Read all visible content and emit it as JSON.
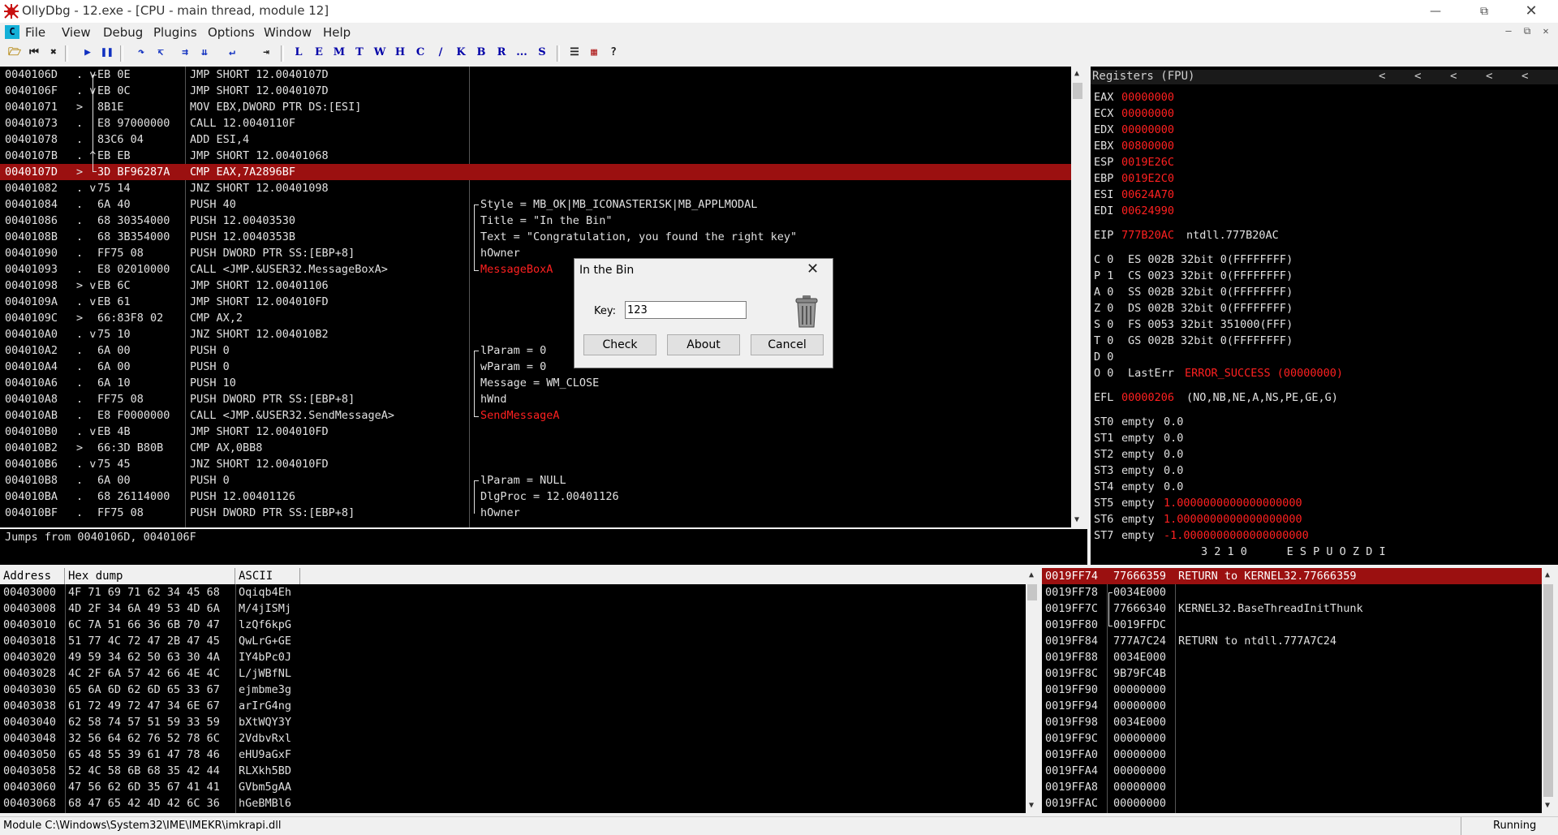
{
  "window": {
    "title": "OllyDbg - 12.exe - [CPU - main thread, module 12]"
  },
  "menu": [
    {
      "label": "File"
    },
    {
      "label": "View"
    },
    {
      "label": "Debug"
    },
    {
      "label": "Plugins"
    },
    {
      "label": "Options"
    },
    {
      "label": "Window"
    },
    {
      "label": "Help"
    }
  ],
  "toolbar_letters": [
    "L",
    "E",
    "M",
    "T",
    "W",
    "H",
    "C",
    "/",
    "K",
    "B",
    "R",
    "...",
    "S"
  ],
  "disasm": [
    {
      "addr": "0040106D",
      "mark": ". v",
      "hex": "EB 0E",
      "cmd": "JMP SHORT 12.0040107D",
      "cmt": ""
    },
    {
      "addr": "0040106F",
      "mark": ". v",
      "hex": "EB 0C",
      "cmd": "JMP SHORT 12.0040107D",
      "cmt": ""
    },
    {
      "addr": "00401071",
      "mark": ">",
      "hex": "8B1E",
      "cmd": "MOV EBX,DWORD PTR DS:[ESI]",
      "cmt": ""
    },
    {
      "addr": "00401073",
      "mark": ".",
      "hex": "E8 97000000",
      "cmd": "CALL 12.0040110F",
      "cmt": ""
    },
    {
      "addr": "00401078",
      "mark": ".",
      "hex": "83C6 04",
      "cmd": "ADD ESI,4",
      "cmt": ""
    },
    {
      "addr": "0040107B",
      "mark": ". ^",
      "hex": "EB EB",
      "cmd": "JMP SHORT 12.00401068",
      "cmt": ""
    },
    {
      "addr": "0040107D",
      "mark": ">",
      "hex": "3D BF96287A",
      "cmd": "CMP EAX,7A2896BF",
      "cmt": ""
    },
    {
      "addr": "00401082",
      "mark": ". v",
      "hex": "75 14",
      "cmd": "JNZ SHORT 12.00401098",
      "cmt": ""
    },
    {
      "addr": "00401084",
      "mark": ".",
      "hex": "6A 40",
      "cmd": "PUSH 40",
      "cmt": "Style = MB_OK|MB_ICONASTERISK|MB_APPLMODAL"
    },
    {
      "addr": "00401086",
      "mark": ".",
      "hex": "68 30354000",
      "cmd": "PUSH 12.00403530",
      "cmt": "Title = \"In the Bin\""
    },
    {
      "addr": "0040108B",
      "mark": ".",
      "hex": "68 3B354000",
      "cmd": "PUSH 12.0040353B",
      "cmt": "Text = \"Congratulation, you found the right key\""
    },
    {
      "addr": "00401090",
      "mark": ".",
      "hex": "FF75 08",
      "cmd": "PUSH DWORD PTR SS:[EBP+8]",
      "cmt": "hOwner"
    },
    {
      "addr": "00401093",
      "mark": ".",
      "hex": "E8 02010000",
      "cmd": "CALL <JMP.&USER32.MessageBoxA>",
      "cmt": "MessageBoxA"
    },
    {
      "addr": "00401098",
      "mark": "> v",
      "hex": "EB 6C",
      "cmd": "JMP SHORT 12.00401106",
      "cmt": ""
    },
    {
      "addr": "0040109A",
      "mark": ". v",
      "hex": "EB 61",
      "cmd": "JMP SHORT 12.004010FD",
      "cmt": ""
    },
    {
      "addr": "0040109C",
      "mark": ">",
      "hex": "66:83F8 02",
      "cmd": "CMP AX,2",
      "cmt": ""
    },
    {
      "addr": "004010A0",
      "mark": ". v",
      "hex": "75 10",
      "cmd": "JNZ SHORT 12.004010B2",
      "cmt": ""
    },
    {
      "addr": "004010A2",
      "mark": ".",
      "hex": "6A 00",
      "cmd": "PUSH 0",
      "cmt": "lParam = 0"
    },
    {
      "addr": "004010A4",
      "mark": ".",
      "hex": "6A 00",
      "cmd": "PUSH 0",
      "cmt": "wParam = 0"
    },
    {
      "addr": "004010A6",
      "mark": ".",
      "hex": "6A 10",
      "cmd": "PUSH 10",
      "cmt": "Message = WM_CLOSE"
    },
    {
      "addr": "004010A8",
      "mark": ".",
      "hex": "FF75 08",
      "cmd": "PUSH DWORD PTR SS:[EBP+8]",
      "cmt": "hWnd"
    },
    {
      "addr": "004010AB",
      "mark": ".",
      "hex": "E8 F0000000",
      "cmd": "CALL <JMP.&USER32.SendMessageA>",
      "cmt": "SendMessageA"
    },
    {
      "addr": "004010B0",
      "mark": ". v",
      "hex": "EB 4B",
      "cmd": "JMP SHORT 12.004010FD",
      "cmt": ""
    },
    {
      "addr": "004010B2",
      "mark": ">",
      "hex": "66:3D B80B",
      "cmd": "CMP AX,0BB8",
      "cmt": ""
    },
    {
      "addr": "004010B6",
      "mark": ". v",
      "hex": "75 45",
      "cmd": "JNZ SHORT 12.004010FD",
      "cmt": ""
    },
    {
      "addr": "004010B8",
      "mark": ".",
      "hex": "6A 00",
      "cmd": "PUSH 0",
      "cmt": "lParam = NULL"
    },
    {
      "addr": "004010BA",
      "mark": ".",
      "hex": "68 26114000",
      "cmd": "PUSH 12.00401126",
      "cmt": "DlgProc = 12.00401126"
    },
    {
      "addr": "004010BF",
      "mark": ".",
      "hex": "FF75 08",
      "cmd": "PUSH DWORD PTR SS:[EBP+8]",
      "cmt": "hOwner"
    }
  ],
  "info_line": "Jumps from 0040106D, 0040106F",
  "registers": {
    "title": "Registers (FPU)",
    "general": [
      {
        "name": "EAX",
        "val": "00000000"
      },
      {
        "name": "ECX",
        "val": "00000000"
      },
      {
        "name": "EDX",
        "val": "00000000"
      },
      {
        "name": "EBX",
        "val": "00800000"
      },
      {
        "name": "ESP",
        "val": "0019E26C"
      },
      {
        "name": "EBP",
        "val": "0019E2C0"
      },
      {
        "name": "ESI",
        "val": "00624A70"
      },
      {
        "name": "EDI",
        "val": "00624990"
      }
    ],
    "eip": {
      "name": "EIP",
      "val": "777B20AC",
      "note": "ntdll.777B20AC"
    },
    "flags": [
      {
        "f": "C 0",
        "seg": "ES 002B 32bit 0(FFFFFFFF)"
      },
      {
        "f": "P 1",
        "seg": "CS 0023 32bit 0(FFFFFFFF)"
      },
      {
        "f": "A 0",
        "seg": "SS 002B 32bit 0(FFFFFFFF)"
      },
      {
        "f": "Z 0",
        "seg": "DS 002B 32bit 0(FFFFFFFF)"
      },
      {
        "f": "S 0",
        "seg": "FS 0053 32bit 351000(FFF)"
      },
      {
        "f": "T 0",
        "seg": "GS 002B 32bit 0(FFFFFFFF)"
      },
      {
        "f": "D 0",
        "seg": ""
      }
    ],
    "lasterr": {
      "f": "O 0",
      "label": "LastErr",
      "val": "ERROR_SUCCESS (00000000)"
    },
    "efl": {
      "label": "EFL",
      "val": "00000206",
      "note": "(NO,NB,NE,A,NS,PE,GE,G)"
    },
    "fpu": [
      {
        "name": "ST0",
        "st": "empty",
        "val": "0.0"
      },
      {
        "name": "ST1",
        "st": "empty",
        "val": "0.0"
      },
      {
        "name": "ST2",
        "st": "empty",
        "val": "0.0"
      },
      {
        "name": "ST3",
        "st": "empty",
        "val": "0.0"
      },
      {
        "name": "ST4",
        "st": "empty",
        "val": "0.0"
      },
      {
        "name": "ST5",
        "st": "empty",
        "val": "1.0000000000000000000"
      },
      {
        "name": "ST6",
        "st": "empty",
        "val": "1.0000000000000000000"
      },
      {
        "name": "ST7",
        "st": "empty",
        "val": "-1.0000000000000000000"
      }
    ],
    "fpu_footer": "3 2 1 0      E S P U O Z D I"
  },
  "dump": {
    "headers": [
      "Address",
      "Hex dump",
      "ASCII"
    ],
    "rows": [
      {
        "a": "00403000",
        "h": "4F 71 69 71 62 34 45 68",
        "s": "Oqiqb4Eh"
      },
      {
        "a": "00403008",
        "h": "4D 2F 34 6A 49 53 4D 6A",
        "s": "M/4jISMj"
      },
      {
        "a": "00403010",
        "h": "6C 7A 51 66 36 6B 70 47",
        "s": "lzQf6kpG"
      },
      {
        "a": "00403018",
        "h": "51 77 4C 72 47 2B 47 45",
        "s": "QwLrG+GE"
      },
      {
        "a": "00403020",
        "h": "49 59 34 62 50 63 30 4A",
        "s": "IY4bPc0J"
      },
      {
        "a": "00403028",
        "h": "4C 2F 6A 57 42 66 4E 4C",
        "s": "L/jWBfNL"
      },
      {
        "a": "00403030",
        "h": "65 6A 6D 62 6D 65 33 67",
        "s": "ejmbme3g"
      },
      {
        "a": "00403038",
        "h": "61 72 49 72 47 34 6E 67",
        "s": "arIrG4ng"
      },
      {
        "a": "00403040",
        "h": "62 58 74 57 51 59 33 59",
        "s": "bXtWQY3Y"
      },
      {
        "a": "00403048",
        "h": "32 56 64 62 76 52 78 6C",
        "s": "2VdbvRxl"
      },
      {
        "a": "00403050",
        "h": "65 48 55 39 61 47 78 46",
        "s": "eHU9aGxF"
      },
      {
        "a": "00403058",
        "h": "52 4C 58 6B 68 35 42 44",
        "s": "RLXkh5BD"
      },
      {
        "a": "00403060",
        "h": "47 56 62 6D 35 67 41 41",
        "s": "GVbm5gAA"
      },
      {
        "a": "00403068",
        "h": "68 47 65 42 4D 42 6C 36",
        "s": "hGeBMBl6"
      }
    ]
  },
  "stack": [
    {
      "a": "0019FF74",
      "v": "77666359",
      "c": "RETURN to KERNEL32.77666359"
    },
    {
      "a": "0019FF78",
      "v": "0034E000",
      "c": ""
    },
    {
      "a": "0019FF7C",
      "v": "77666340",
      "c": "KERNEL32.BaseThreadInitThunk"
    },
    {
      "a": "0019FF80",
      "v": "0019FFDC",
      "c": ""
    },
    {
      "a": "0019FF84",
      "v": "777A7C24",
      "c": "RETURN to ntdll.777A7C24"
    },
    {
      "a": "0019FF88",
      "v": "0034E000",
      "c": ""
    },
    {
      "a": "0019FF8C",
      "v": "9B79FC4B",
      "c": ""
    },
    {
      "a": "0019FF90",
      "v": "00000000",
      "c": ""
    },
    {
      "a": "0019FF94",
      "v": "00000000",
      "c": ""
    },
    {
      "a": "0019FF98",
      "v": "0034E000",
      "c": ""
    },
    {
      "a": "0019FF9C",
      "v": "00000000",
      "c": ""
    },
    {
      "a": "0019FFA0",
      "v": "00000000",
      "c": ""
    },
    {
      "a": "0019FFA4",
      "v": "00000000",
      "c": ""
    },
    {
      "a": "0019FFA8",
      "v": "00000000",
      "c": ""
    },
    {
      "a": "0019FFAC",
      "v": "00000000",
      "c": ""
    }
  ],
  "dialog": {
    "title": "In the Bin",
    "key_label": "Key:",
    "key_value": "123",
    "check": "Check",
    "about": "About",
    "cancel": "Cancel"
  },
  "status": {
    "module": "Module C:\\Windows\\System32\\IME\\IMEKR\\imkrapi.dll",
    "state": "Running"
  },
  "colors": {
    "highlight": "#9b1010",
    "register_value": "#ff2020",
    "pane_bg": "#000000"
  }
}
